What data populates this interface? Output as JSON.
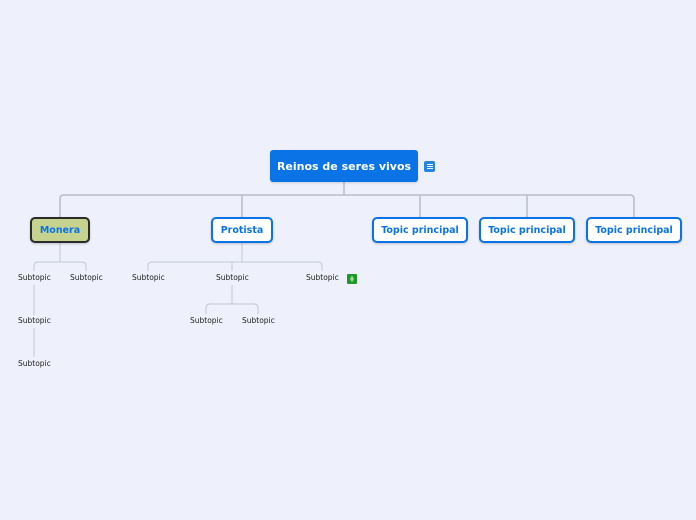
{
  "mindmap": {
    "central": {
      "label": "Reinos de seres vivos"
    },
    "topics": [
      {
        "label": "Monera"
      },
      {
        "label": "Protista"
      },
      {
        "label": "Topic principal"
      },
      {
        "label": "Topic principal"
      },
      {
        "label": "Topic principal"
      }
    ],
    "monera_subtopics": [
      {
        "label": "Subtopic"
      },
      {
        "label": "Subtopic"
      },
      {
        "label": "Subtopic"
      },
      {
        "label": "Subtopic"
      }
    ],
    "protista_subtopics": [
      {
        "label": "Subtopic"
      },
      {
        "label": "Subtopic"
      },
      {
        "label": "Subtopic"
      },
      {
        "label": "Subtopic"
      },
      {
        "label": "Subtopic"
      }
    ]
  },
  "colors": {
    "background": "#eef0fb",
    "central_fill": "#0a74e6",
    "topic_border": "#0a74e6",
    "selected_fill": "#c5d38e",
    "connector": "#b9bdc9"
  },
  "icons": {
    "central_note": "note-icon",
    "subtopic_attachment": "leaf-icon"
  }
}
